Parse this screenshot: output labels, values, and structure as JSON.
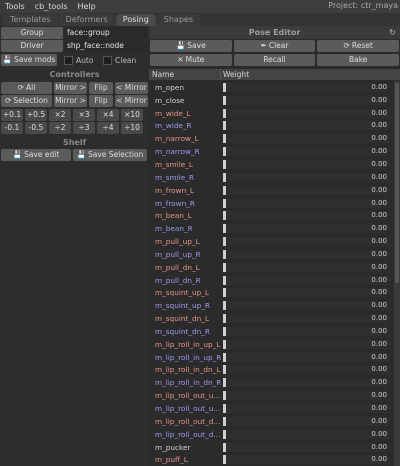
{
  "menu": [
    "Tools",
    "cb_tools",
    "Help"
  ],
  "project": "Project: ctr_maya",
  "tabs": [
    {
      "label": "Templates",
      "active": false
    },
    {
      "label": "Deformers",
      "active": false
    },
    {
      "label": "Posing",
      "active": true
    },
    {
      "label": "Shapes",
      "active": false
    }
  ],
  "left": {
    "group_label": "Group",
    "group_value": "face::group",
    "driver_label": "Driver",
    "driver_value": "shp_face::node",
    "save_mods": "Save mods",
    "auto": "Auto",
    "clean": "Clean",
    "controllers_title": "Controllers",
    "all": "All",
    "mirror_r": "Mirror >",
    "flip": "Flip",
    "mirror_l": "< Mirror",
    "selection": "Selection",
    "steps_row1": [
      "+0.1",
      "+0.5",
      "×2",
      "×3",
      "×4",
      "×10"
    ],
    "steps_row2": [
      "-0.1",
      "-0.5",
      "÷2",
      "÷3",
      "÷4",
      "÷10"
    ],
    "shelf_title": "Shelf",
    "save_edit": "Save edit",
    "save_selection": "Save Selection"
  },
  "pose_editor": {
    "title": "Pose Editor",
    "save": "Save",
    "clear": "Clear",
    "reset": "Reset",
    "mute": "Mute",
    "recall": "Recall",
    "bake": "Bake",
    "col_name": "Name",
    "col_weight": "Weight"
  },
  "colors": {
    "neutral": "#d4d4d4",
    "left_side": "#e8958a",
    "right_side": "#9a9cf0"
  },
  "poses": [
    {
      "name": "m_open",
      "weight": "0.00",
      "side": "neutral"
    },
    {
      "name": "m_close",
      "weight": "0.00",
      "side": "neutral"
    },
    {
      "name": "m_wide_L",
      "weight": "0.00",
      "side": "left_side"
    },
    {
      "name": "m_wide_R",
      "weight": "0.00",
      "side": "right_side"
    },
    {
      "name": "m_narrow_L",
      "weight": "0.00",
      "side": "left_side"
    },
    {
      "name": "m_narrow_R",
      "weight": "0.00",
      "side": "right_side"
    },
    {
      "name": "m_smile_L",
      "weight": "0.00",
      "side": "left_side"
    },
    {
      "name": "m_smile_R",
      "weight": "0.00",
      "side": "right_side"
    },
    {
      "name": "m_frown_L",
      "weight": "0.00",
      "side": "left_side"
    },
    {
      "name": "m_frown_R",
      "weight": "0.00",
      "side": "right_side"
    },
    {
      "name": "m_bean_L",
      "weight": "0.00",
      "side": "left_side"
    },
    {
      "name": "m_bean_R",
      "weight": "0.00",
      "side": "right_side"
    },
    {
      "name": "m_pull_up_L",
      "weight": "0.00",
      "side": "left_side"
    },
    {
      "name": "m_pull_up_R",
      "weight": "0.00",
      "side": "right_side"
    },
    {
      "name": "m_pull_dn_L",
      "weight": "0.00",
      "side": "left_side"
    },
    {
      "name": "m_pull_dn_R",
      "weight": "0.00",
      "side": "right_side"
    },
    {
      "name": "m_squint_up_L",
      "weight": "0.00",
      "side": "left_side"
    },
    {
      "name": "m_squint_up_R",
      "weight": "0.00",
      "side": "right_side"
    },
    {
      "name": "m_squint_dn_L",
      "weight": "0.00",
      "side": "left_side"
    },
    {
      "name": "m_squint_dn_R",
      "weight": "0.00",
      "side": "right_side"
    },
    {
      "name": "m_lip_roll_in_up_L",
      "weight": "0.00",
      "side": "left_side"
    },
    {
      "name": "m_lip_roll_in_up_R",
      "weight": "0.00",
      "side": "right_side"
    },
    {
      "name": "m_lip_roll_in_dn_L",
      "weight": "0.00",
      "side": "left_side"
    },
    {
      "name": "m_lip_roll_in_dn_R",
      "weight": "0.00",
      "side": "right_side"
    },
    {
      "name": "m_lip_roll_out_u...",
      "weight": "0.00",
      "side": "left_side"
    },
    {
      "name": "m_lip_roll_out_u...",
      "weight": "0.00",
      "side": "right_side"
    },
    {
      "name": "m_lip_roll_out_d...",
      "weight": "0.00",
      "side": "left_side"
    },
    {
      "name": "m_lip_roll_out_d...",
      "weight": "0.00",
      "side": "right_side"
    },
    {
      "name": "m_pucker",
      "weight": "0.00",
      "side": "neutral"
    },
    {
      "name": "m_puff_L",
      "weight": "0.00",
      "side": "left_side"
    }
  ]
}
